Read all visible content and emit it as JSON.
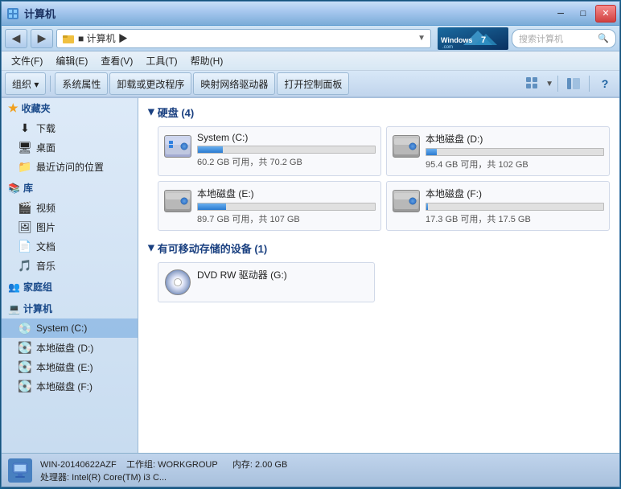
{
  "window": {
    "title": "计算机",
    "title_prefix": "■ 计算机 ▶"
  },
  "titlebar": {
    "minimize_label": "─",
    "maximize_label": "□",
    "close_label": "✕"
  },
  "addressbar": {
    "back_label": "◀",
    "forward_label": "▶",
    "address": "计算机 ▶",
    "address_full": "■  计算机  ▶",
    "search_placeholder": "搜索计算机",
    "logo_text": "Windows7.com"
  },
  "menubar": {
    "items": [
      {
        "label": "文件(F)"
      },
      {
        "label": "编辑(E)"
      },
      {
        "label": "查看(V)"
      },
      {
        "label": "工具(T)"
      },
      {
        "label": "帮助(H)"
      }
    ]
  },
  "toolbar": {
    "organize_label": "组织 ▾",
    "system_props_label": "系统属性",
    "uninstall_label": "卸载或更改程序",
    "map_drive_label": "映射网络驱动器",
    "control_panel_label": "打开控制面板"
  },
  "sidebar": {
    "favorites": {
      "header": "收藏夹",
      "items": [
        {
          "label": "下载",
          "icon": "📥"
        },
        {
          "label": "桌面",
          "icon": "🖥"
        },
        {
          "label": "最近访问的位置",
          "icon": "📁"
        }
      ]
    },
    "library": {
      "header": "库",
      "items": [
        {
          "label": "视频",
          "icon": "🎬"
        },
        {
          "label": "图片",
          "icon": "🖼"
        },
        {
          "label": "文档",
          "icon": "📄"
        },
        {
          "label": "音乐",
          "icon": "🎵"
        }
      ]
    },
    "homegroup": {
      "header": "家庭组",
      "icon": "👥"
    },
    "computer": {
      "header": "计算机",
      "items": [
        {
          "label": "System (C:)",
          "icon": "💿",
          "active": true
        },
        {
          "label": "本地磁盘 (D:)",
          "icon": "💽"
        },
        {
          "label": "本地磁盘 (E:)",
          "icon": "💽"
        },
        {
          "label": "本地磁盘 (F:)",
          "icon": "💽"
        }
      ]
    }
  },
  "content": {
    "hard_disks_header": "硬盘 (4)",
    "removable_header": "有可移动存储的设备 (1)",
    "drives": [
      {
        "name": "System (C:)",
        "free": "60.2 GB 可用，共 70.2 GB",
        "used_pct": 14,
        "bar_class": ""
      },
      {
        "name": "本地磁盘 (D:)",
        "free": "95.4 GB 可用，共 102 GB",
        "used_pct": 6,
        "bar_class": ""
      },
      {
        "name": "本地磁盘 (E:)",
        "free": "89.7 GB 可用，共 107 GB",
        "used_pct": 16,
        "bar_class": ""
      },
      {
        "name": "本地磁盘 (F:)",
        "free": "17.3 GB 可用，共 17.5 GB",
        "used_pct": 1,
        "bar_class": ""
      }
    ],
    "removable_drives": [
      {
        "name": "DVD RW 驱动器 (G:)",
        "type": "dvd"
      }
    ]
  },
  "statusbar": {
    "computer_name": "WIN-20140622AZF",
    "workgroup_label": "工作组: WORKGROUP",
    "memory_label": "内存: 2.00 GB",
    "processor_label": "处理器: Intel(R) Core(TM) i3 C..."
  }
}
